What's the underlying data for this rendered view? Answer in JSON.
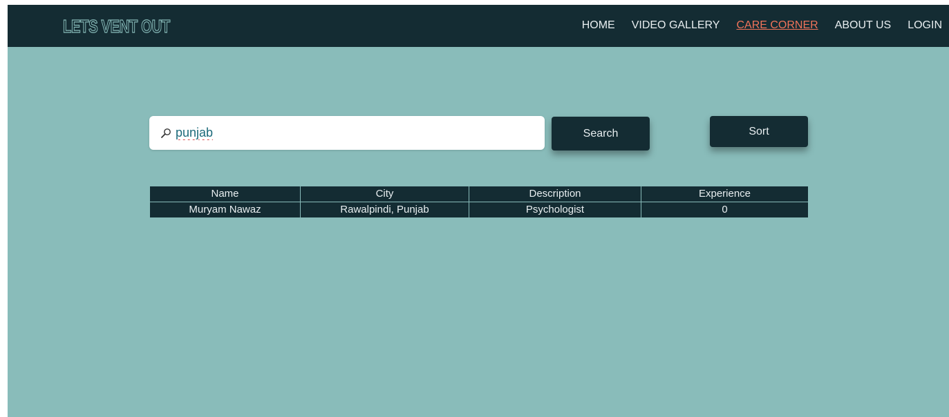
{
  "brand": {
    "title": "LETS VENT OUT"
  },
  "nav": {
    "items": [
      {
        "label": "HOME",
        "active": false
      },
      {
        "label": "VIDEO GALLERY",
        "active": false
      },
      {
        "label": "CARE CORNER",
        "active": true
      },
      {
        "label": "ABOUT US",
        "active": false
      },
      {
        "label": "LOGIN",
        "active": false
      }
    ]
  },
  "search": {
    "value": "punjab",
    "button_label": "Search"
  },
  "sort": {
    "button_label": "Sort"
  },
  "table": {
    "headers": [
      "Name",
      "City",
      "Description",
      "Experience"
    ],
    "rows": [
      [
        "Muryam Nawaz",
        "Rawalpindi, Punjab",
        "Psychologist",
        "0"
      ]
    ]
  },
  "colors": {
    "page_background": "#89bcba",
    "navbar": "#142c33",
    "active_link": "#f0735a",
    "button": "#142c33"
  }
}
